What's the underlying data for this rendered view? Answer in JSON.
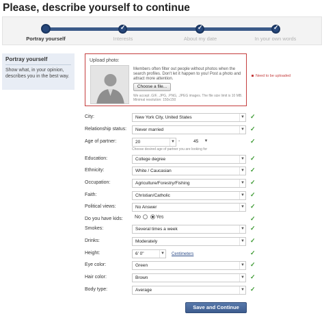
{
  "page": {
    "title": "Please, describe yourself to continue"
  },
  "progress": {
    "steps": [
      {
        "label": "Portray yourself"
      },
      {
        "label": "Interests"
      },
      {
        "label": "About my date"
      },
      {
        "label": "In your own words"
      }
    ]
  },
  "sidebar": {
    "title": "Portray yourself",
    "description": "Show what, in your opinion, describes you in the best way."
  },
  "upload": {
    "label": "Upload photo:",
    "text": "Members often filter out people without photos when the search profiles. Don't let it happen to you! Post a photo and attract more attention.",
    "button_label": "Choose a file...",
    "hint": "We accept .GIF, .JPG, .PNG, .JPEG images. The file size limit is 10 MB. Minimal resolution: 150x150",
    "required_note": "Need to be uploaded"
  },
  "fields": {
    "city": {
      "label": "City:",
      "value": "New York City, United States"
    },
    "relationship": {
      "label": "Relationship status:",
      "value": "Never married"
    },
    "age": {
      "label": "Age of partner:",
      "from": "20",
      "to": "45",
      "hint": "Choose desired age of partner you are looking for"
    },
    "education": {
      "label": "Education:",
      "value": "College degree"
    },
    "ethnicity": {
      "label": "Ethnicity:",
      "value": "White / Caucasian"
    },
    "occupation": {
      "label": "Occupation:",
      "value": "Agriculture/Forestry/Fishing"
    },
    "faith": {
      "label": "Faith:",
      "value": "Christian/Catholic"
    },
    "political": {
      "label": "Political views:",
      "value": "No Answer"
    },
    "kids": {
      "label": "Do you have kids:",
      "no_label": "No",
      "yes_label": "Yes",
      "selected": "Yes"
    },
    "smokes": {
      "label": "Smokes:",
      "value": "Several times a week"
    },
    "drinks": {
      "label": "Drinks:",
      "value": "Moderately"
    },
    "height": {
      "label": "Height:",
      "value": "6' 0\"",
      "unit_link": "Centimeters"
    },
    "eye": {
      "label": "Eye color:",
      "value": "Green"
    },
    "hair": {
      "label": "Hair color:",
      "value": "Brown"
    },
    "body": {
      "label": "Body type:",
      "value": "Average"
    }
  },
  "icons": {
    "check": "✓",
    "dropdown": "▼",
    "status_color": "#3c9a32",
    "error_color": "#c43c3c",
    "accent": "#3b5a88"
  },
  "submit": {
    "label": "Save and Continue"
  }
}
